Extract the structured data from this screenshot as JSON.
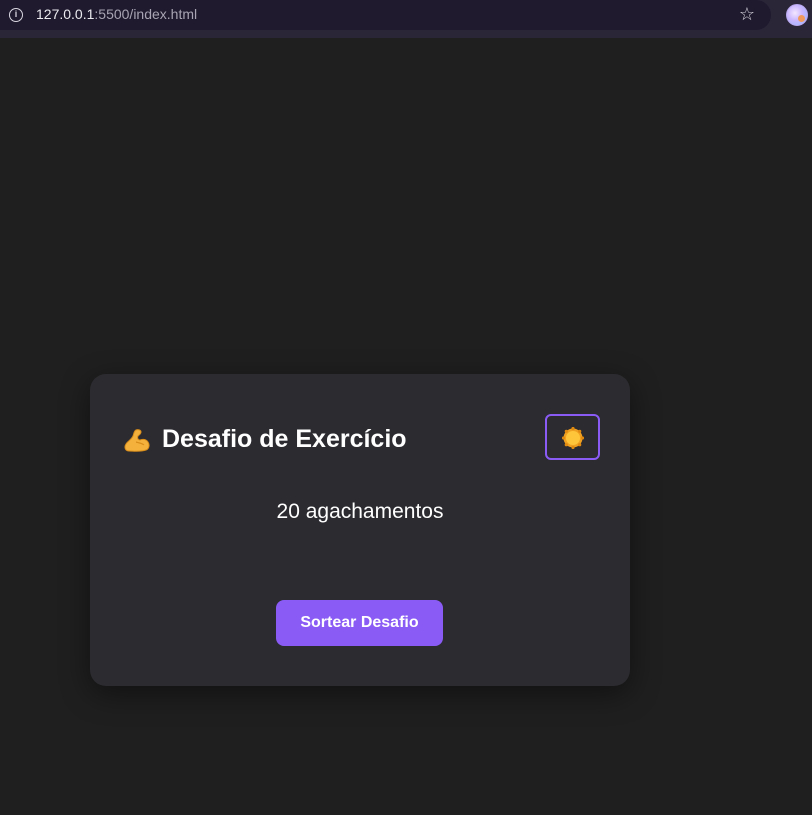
{
  "browser": {
    "url_host": "127.0.0.1",
    "url_path": ":5500/index.html",
    "icons": {
      "site_info": "info-icon",
      "bookmark": "star-icon",
      "profile": "avatar"
    }
  },
  "card": {
    "title_icon": "flexed-biceps-icon",
    "title": "Desafio de Exercício",
    "theme_toggle_icon": "sun-icon",
    "challenge": "20 agachamentos",
    "draw_button_label": "Sortear Desafio"
  },
  "colors": {
    "page_background": "#1f1f1f",
    "card_background": "#2c2b30",
    "accent": "#8a5cf5",
    "text": "#ffffff"
  }
}
